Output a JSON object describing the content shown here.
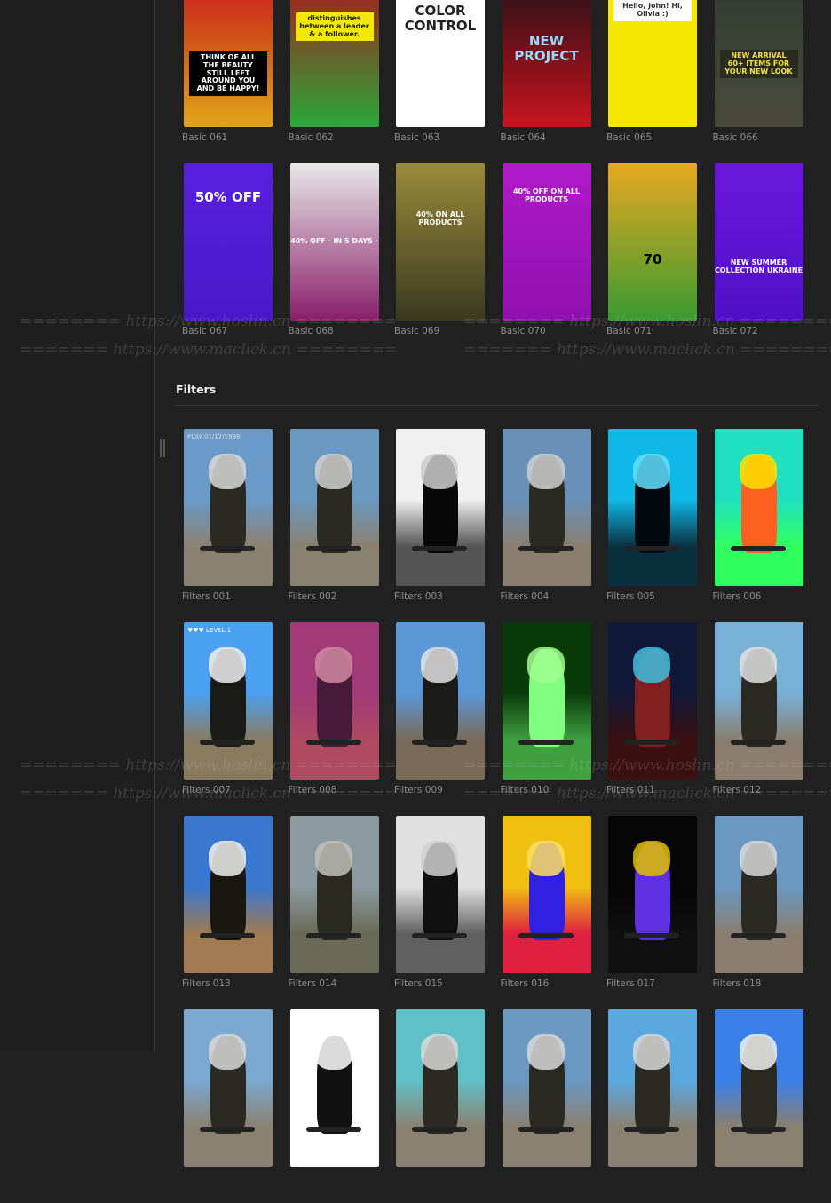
{
  "basic": {
    "items": [
      {
        "label": "Basic 061",
        "colors": [
          "#c8141c",
          "#e0a418"
        ],
        "overlay": "THINK OF ALL THE BEAUTY STILL LEFT AROUND YOU AND BE HAPPY!",
        "ovColor": "#ffffff",
        "ovBg": "#000000",
        "ovTop": 92
      },
      {
        "label": "Basic 062",
        "colors": [
          "#b0121a",
          "#2aa83a"
        ],
        "overlay": "distinguishes between a leader & a follower.",
        "ovColor": "#222222",
        "ovBg": "#f5e800",
        "ovTop": 48
      },
      {
        "label": "Basic 063",
        "colors": [
          "#ffffff",
          "#ffffff"
        ],
        "overlay": "COLOR CONTROL",
        "ovColor": "#222222",
        "ovBg": "",
        "ovTop": 38
      },
      {
        "label": "Basic 064",
        "colors": [
          "#1c1016",
          "#c8141e"
        ],
        "overlay": "NEW PROJECT",
        "ovColor": "#9fd8ff",
        "ovBg": "",
        "ovTop": 72
      },
      {
        "label": "Basic 065",
        "colors": [
          "#f7e600",
          "#f7e600"
        ],
        "overlay": "Hello, John!  Hi, Olivia :)",
        "ovColor": "#333333",
        "ovBg": "#ffffff",
        "ovTop": 34
      },
      {
        "label": "Basic 066",
        "colors": [
          "#2e3a30",
          "#4a4a3a"
        ],
        "overlay": "NEW ARRIVAL 60+ ITEMS FOR YOUR NEW LOOK",
        "ovColor": "#f5e04a",
        "ovBg": "rgba(0,0,0,0.35)",
        "ovTop": 90
      },
      {
        "label": "Basic 067",
        "colors": [
          "#5a1ee0",
          "#4a18c8"
        ],
        "overlay": "50% OFF",
        "ovColor": "#ffffff",
        "ovBg": "",
        "ovTop": 30
      },
      {
        "label": "Basic 068",
        "colors": [
          "#e8e8e8",
          "#8a1f6a"
        ],
        "overlay": "40% OFF · IN 5 DAYS ·",
        "ovColor": "#ffffff",
        "ovBg": "",
        "ovTop": 84
      },
      {
        "label": "Basic 069",
        "colors": [
          "#9a8a3a",
          "#3a3a20"
        ],
        "overlay": "40% ON ALL PRODUCTS",
        "ovColor": "#ffffff",
        "ovBg": "",
        "ovTop": 54
      },
      {
        "label": "Basic 070",
        "colors": [
          "#b01ac8",
          "#9010b0"
        ],
        "overlay": "40% OFF ON ALL PRODUCTS",
        "ovColor": "#ffffff",
        "ovBg": "",
        "ovTop": 28
      },
      {
        "label": "Basic 071",
        "colors": [
          "#e8a820",
          "#3a9a30"
        ],
        "overlay": "70",
        "ovColor": "#000000",
        "ovBg": "",
        "ovTop": 100
      },
      {
        "label": "Basic 072",
        "colors": [
          "#6a18d8",
          "#5010c8"
        ],
        "overlay": "NEW SUMMER COLLECTION UKRAINE",
        "ovColor": "#ffffff",
        "ovBg": "",
        "ovTop": 108
      }
    ]
  },
  "filters": {
    "title": "Filters",
    "items": [
      {
        "label": "Filters 001",
        "tone": [
          "#6a9ac8",
          "#8a8070",
          "#2a2a22",
          "#d8d8d8"
        ],
        "overlay": "PLAY   01/12/1998"
      },
      {
        "label": "Filters 002",
        "tone": [
          "#6a98c0",
          "#8a8070",
          "#2a2a22",
          "#d0d0d0"
        ],
        "overlay": ""
      },
      {
        "label": "Filters 003",
        "tone": [
          "#f0f0f0",
          "#555555",
          "#080808",
          "#cccccc"
        ],
        "overlay": ""
      },
      {
        "label": "Filters 004",
        "tone": [
          "#6890b8",
          "#8a7e70",
          "#2a2a22",
          "#d0d0d0"
        ],
        "overlay": ""
      },
      {
        "label": "Filters 005",
        "tone": [
          "#10b8e8",
          "#0a3040",
          "#020a10",
          "#60e0ff"
        ],
        "overlay": ""
      },
      {
        "label": "Filters 006",
        "tone": [
          "#20e0c0",
          "#30ff60",
          "#ff6020",
          "#ffe000"
        ],
        "overlay": ""
      },
      {
        "label": "Filters 007",
        "tone": [
          "#4aa0f0",
          "#8a7a60",
          "#1a1a16",
          "#f0f0f0"
        ],
        "overlay": "♥♥♥   LEVEL 1"
      },
      {
        "label": "Filters 008",
        "tone": [
          "#a03a78",
          "#b04a60",
          "#4a1a3a",
          "#d08aa0"
        ],
        "overlay": ""
      },
      {
        "label": "Filters 009",
        "tone": [
          "#5a98d8",
          "#7a6a58",
          "#1a1a18",
          "#e0e0e0"
        ],
        "overlay": ""
      },
      {
        "label": "Filters 010",
        "tone": [
          "#0a3a0a",
          "#40a040",
          "#80ff80",
          "#a0ff90"
        ],
        "overlay": ""
      },
      {
        "label": "Filters 011",
        "tone": [
          "#101838",
          "#3a1010",
          "#802020",
          "#40c0e0"
        ],
        "overlay": ""
      },
      {
        "label": "Filters 012",
        "tone": [
          "#78b0d8",
          "#8a7e70",
          "#2a2a22",
          "#e0e0e0"
        ],
        "overlay": ""
      },
      {
        "label": "Filters 013",
        "tone": [
          "#3a78d0",
          "#a07a50",
          "#181810",
          "#f0f0f0"
        ],
        "overlay": ""
      },
      {
        "label": "Filters 014",
        "tone": [
          "#8a9aa0",
          "#6a6a58",
          "#2a2a20",
          "#c0c0b8"
        ],
        "overlay": ""
      },
      {
        "label": "Filters 015",
        "tone": [
          "#e0e0e0",
          "#606060",
          "#101010",
          "#d0d0d0"
        ],
        "overlay": ""
      },
      {
        "label": "Filters 016",
        "tone": [
          "#f0c010",
          "#e02040",
          "#3020e0",
          "#ffe060"
        ],
        "overlay": ""
      },
      {
        "label": "Filters 017",
        "tone": [
          "#050505",
          "#101010",
          "#6030e0",
          "#e0c000"
        ],
        "overlay": ""
      },
      {
        "label": "Filters 018",
        "tone": [
          "#6a98c0",
          "#8a7e70",
          "#2a2a22",
          "#d8d8d8"
        ],
        "overlay": ""
      },
      {
        "label": "",
        "tone": [
          "#7aa8d0",
          "#8a8070",
          "#2a2a22",
          "#d8d8d8"
        ],
        "overlay": ""
      },
      {
        "label": "",
        "tone": [
          "#ffffff",
          "#ffffff",
          "#111111",
          "#ffffff"
        ],
        "overlay": ""
      },
      {
        "label": "",
        "tone": [
          "#60c0c8",
          "#8a8070",
          "#2a2a22",
          "#d8d8d8"
        ],
        "overlay": ""
      },
      {
        "label": "",
        "tone": [
          "#6a98c0",
          "#8a8070",
          "#2a2a22",
          "#d8d8d8"
        ],
        "overlay": ""
      },
      {
        "label": "",
        "tone": [
          "#5aa8e0",
          "#8a8070",
          "#2a2a22",
          "#d8d8d8"
        ],
        "overlay": ""
      },
      {
        "label": "",
        "tone": [
          "#3a80e8",
          "#8a8070",
          "#2a2a22",
          "#f0f0f0"
        ],
        "overlay": ""
      }
    ]
  },
  "watermarks": {
    "a": "======== https://www.hoslin.cn ========",
    "b": "======= https://www.maclick.cn ========"
  }
}
